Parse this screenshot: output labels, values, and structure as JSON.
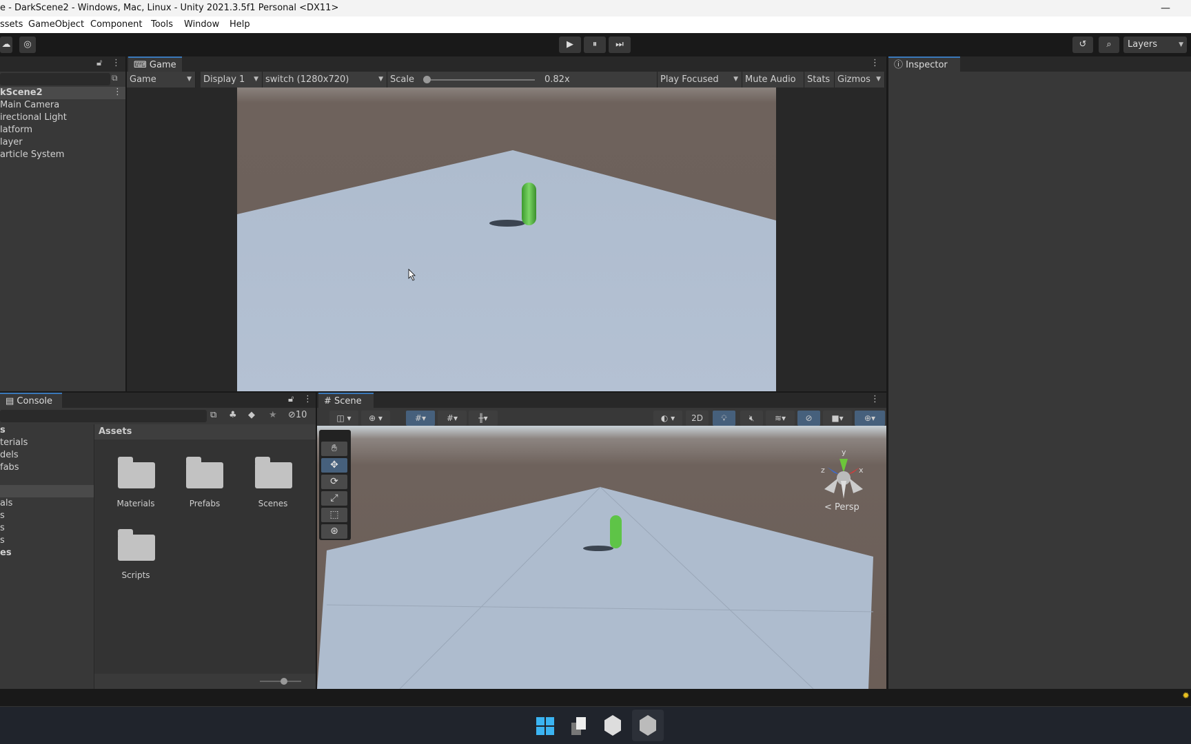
{
  "window": {
    "title": "e - DarkScene2 - Windows, Mac, Linux - Unity 2021.3.5f1 Personal <DX11>",
    "minimize": "—"
  },
  "menu": [
    "ssets",
    "GameObject",
    "Component",
    "Tools",
    "Window",
    "Help"
  ],
  "toolbar": {
    "play": "▶",
    "pause": "⏸",
    "step": "⏭",
    "layers": "Layers"
  },
  "hierarchy": {
    "scene": "kScene2",
    "items": [
      "Main Camera",
      "irectional Light",
      "latform",
      "layer",
      "article System"
    ]
  },
  "game": {
    "tab": "Game",
    "view_mode": "Game",
    "display": "Display 1",
    "resolution": "switch (1280x720)",
    "scale_label": "Scale",
    "scale_value": "0.82x",
    "scale_fraction": 0,
    "play_mode": "Play Focused",
    "mute": "Mute Audio",
    "stats": "Stats",
    "gizmos": "Gizmos"
  },
  "inspector": {
    "tab": "Inspector"
  },
  "console": {
    "tab": "Console",
    "hidden_count": "10"
  },
  "project": {
    "tree": [
      "s",
      "terials",
      "dels",
      "fabs",
      "",
      "als",
      "s",
      "s",
      "s",
      "es"
    ],
    "header": "Assets",
    "folders": [
      "Materials",
      "Prefabs",
      "Scenes",
      "Scripts"
    ]
  },
  "scene": {
    "tab": "Scene",
    "btn_2d": "2D",
    "persp": "Persp",
    "axis_x": "x",
    "axis_y": "y",
    "axis_z": "z"
  },
  "colors": {
    "accent": "#3a79bb",
    "active_btn": "#46607c",
    "sky": "#6e625c",
    "floor": "#aab8ca",
    "capsule": "#4caf3a"
  }
}
